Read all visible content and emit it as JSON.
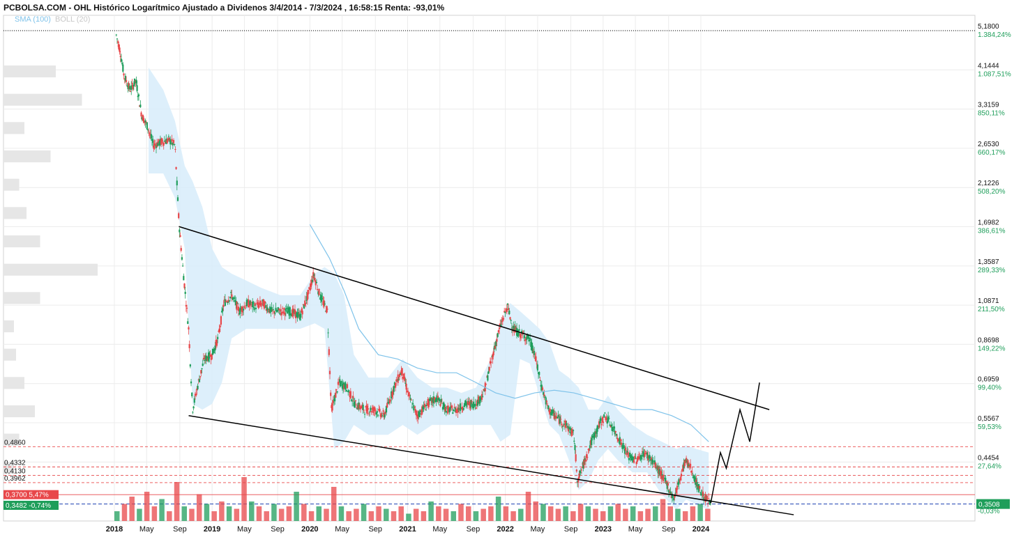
{
  "title": "PCBOLSA.COM - OHL Histórico Logarítmico Ajustado a Dividenos 3/4/2014 - 7/3/2024 , 16:58:15 Renta: -93,01%",
  "legend": {
    "sma": "SMA (100)",
    "boll": "BOLL (20)"
  },
  "colors": {
    "up": "#1f9e5c",
    "down": "#e8474a",
    "sma": "#7fc3ea",
    "boll_fill": "#d7ecfa",
    "trendline": "#000000",
    "level": "#e8474a",
    "current": "#1e9e5a"
  },
  "chart_data": {
    "type": "candlestick",
    "scale": "log",
    "title": "OHL Histórico Logarítmico Ajustado a Dividenos 3/4/2014 - 7/3/2024",
    "ylim": [
      0.33,
      5.3
    ],
    "y_ticks": [
      {
        "value": 5.18,
        "label": "5,1800",
        "pct": "1.384,24%"
      },
      {
        "value": 4.1444,
        "label": "4,1444",
        "pct": "1.087,51%"
      },
      {
        "value": 3.3159,
        "label": "3,3159",
        "pct": "850,11%"
      },
      {
        "value": 2.653,
        "label": "2,6530",
        "pct": "660,17%"
      },
      {
        "value": 2.1226,
        "label": "2,1226",
        "pct": "508,20%"
      },
      {
        "value": 1.6982,
        "label": "1,6982",
        "pct": "386,61%"
      },
      {
        "value": 1.3587,
        "label": "1,3587",
        "pct": "289,33%"
      },
      {
        "value": 1.0871,
        "label": "1,0871",
        "pct": "211,50%"
      },
      {
        "value": 0.8698,
        "label": "0,8698",
        "pct": "149,22%"
      },
      {
        "value": 0.6959,
        "label": "0,6959",
        "pct": "99,40%"
      },
      {
        "value": 0.5567,
        "label": "0,5567",
        "pct": "59,53%"
      },
      {
        "value": 0.4454,
        "label": "0,4454",
        "pct": "27,64%"
      },
      {
        "value": 0.3489,
        "label": "",
        "pct": "-0,03%"
      }
    ],
    "x_ticks": [
      {
        "t": 2018.0,
        "label": "2018",
        "bold": true
      },
      {
        "t": 2018.33,
        "label": "May",
        "bold": false
      },
      {
        "t": 2018.67,
        "label": "Sep",
        "bold": false
      },
      {
        "t": 2019.0,
        "label": "2019",
        "bold": true
      },
      {
        "t": 2019.33,
        "label": "May",
        "bold": false
      },
      {
        "t": 2019.67,
        "label": "Sep",
        "bold": false
      },
      {
        "t": 2020.0,
        "label": "2020",
        "bold": true
      },
      {
        "t": 2020.33,
        "label": "May",
        "bold": false
      },
      {
        "t": 2020.67,
        "label": "Sep",
        "bold": false
      },
      {
        "t": 2021.0,
        "label": "2021",
        "bold": true
      },
      {
        "t": 2021.33,
        "label": "May",
        "bold": false
      },
      {
        "t": 2021.67,
        "label": "Sep",
        "bold": false
      },
      {
        "t": 2022.0,
        "label": "2022",
        "bold": true
      },
      {
        "t": 2022.33,
        "label": "May",
        "bold": false
      },
      {
        "t": 2022.67,
        "label": "Sep",
        "bold": false
      },
      {
        "t": 2023.0,
        "label": "2023",
        "bold": true
      },
      {
        "t": 2023.33,
        "label": "May",
        "bold": false
      },
      {
        "t": 2023.67,
        "label": "Sep",
        "bold": false
      },
      {
        "t": 2024.0,
        "label": "2024",
        "bold": true
      }
    ],
    "levels": [
      {
        "value": 0.486,
        "label": "0,4860"
      },
      {
        "value": 0.4332,
        "label": "0,4332"
      },
      {
        "value": 0.413,
        "label": "0,4130"
      },
      {
        "value": 0.3962,
        "label": "0,3962"
      }
    ],
    "max_line": 5.18,
    "price_tags": [
      {
        "value": 0.37,
        "label": "0,3700",
        "pct": "5,47%",
        "color": "#e8474a"
      },
      {
        "value": 0.3482,
        "label": "0,3482",
        "pct": "-0,74%",
        "color": "#1e9e5a"
      }
    ],
    "last_price": {
      "value": 0.3508,
      "label": "0,3508"
    },
    "price_path": [
      [
        2018.02,
        5.05
      ],
      [
        2018.06,
        4.6
      ],
      [
        2018.1,
        4.0
      ],
      [
        2018.16,
        3.7
      ],
      [
        2018.22,
        3.9
      ],
      [
        2018.28,
        3.2
      ],
      [
        2018.34,
        3.0
      ],
      [
        2018.4,
        2.7
      ],
      [
        2018.48,
        2.75
      ],
      [
        2018.56,
        2.78
      ],
      [
        2018.62,
        2.7
      ],
      [
        2018.66,
        1.75
      ],
      [
        2018.7,
        1.35
      ],
      [
        2018.76,
        0.95
      ],
      [
        2018.8,
        0.6
      ],
      [
        2018.86,
        0.7
      ],
      [
        2018.92,
        0.8
      ],
      [
        2019.0,
        0.82
      ],
      [
        2019.06,
        0.9
      ],
      [
        2019.12,
        1.1
      ],
      [
        2019.2,
        1.15
      ],
      [
        2019.28,
        1.05
      ],
      [
        2019.36,
        1.1
      ],
      [
        2019.44,
        1.08
      ],
      [
        2019.52,
        1.1
      ],
      [
        2019.6,
        1.05
      ],
      [
        2019.7,
        1.05
      ],
      [
        2019.8,
        1.05
      ],
      [
        2019.9,
        1.02
      ],
      [
        2019.98,
        1.15
      ],
      [
        2020.04,
        1.3
      ],
      [
        2020.1,
        1.15
      ],
      [
        2020.18,
        1.05
      ],
      [
        2020.22,
        0.6
      ],
      [
        2020.3,
        0.7
      ],
      [
        2020.38,
        0.68
      ],
      [
        2020.46,
        0.62
      ],
      [
        2020.56,
        0.6
      ],
      [
        2020.66,
        0.6
      ],
      [
        2020.76,
        0.58
      ],
      [
        2020.86,
        0.68
      ],
      [
        2020.94,
        0.75
      ],
      [
        2021.02,
        0.64
      ],
      [
        2021.1,
        0.58
      ],
      [
        2021.2,
        0.62
      ],
      [
        2021.3,
        0.64
      ],
      [
        2021.4,
        0.6
      ],
      [
        2021.5,
        0.6
      ],
      [
        2021.6,
        0.62
      ],
      [
        2021.7,
        0.62
      ],
      [
        2021.78,
        0.66
      ],
      [
        2021.86,
        0.8
      ],
      [
        2021.94,
        0.95
      ],
      [
        2022.02,
        1.08
      ],
      [
        2022.08,
        0.95
      ],
      [
        2022.16,
        0.92
      ],
      [
        2022.24,
        0.9
      ],
      [
        2022.3,
        0.82
      ],
      [
        2022.36,
        0.7
      ],
      [
        2022.44,
        0.6
      ],
      [
        2022.54,
        0.57
      ],
      [
        2022.62,
        0.55
      ],
      [
        2022.7,
        0.52
      ],
      [
        2022.74,
        0.4
      ],
      [
        2022.8,
        0.44
      ],
      [
        2022.88,
        0.5
      ],
      [
        2022.96,
        0.55
      ],
      [
        2023.02,
        0.58
      ],
      [
        2023.1,
        0.54
      ],
      [
        2023.18,
        0.5
      ],
      [
        2023.26,
        0.46
      ],
      [
        2023.34,
        0.45
      ],
      [
        2023.42,
        0.47
      ],
      [
        2023.5,
        0.45
      ],
      [
        2023.58,
        0.42
      ],
      [
        2023.66,
        0.39
      ],
      [
        2023.72,
        0.36
      ],
      [
        2023.78,
        0.4
      ],
      [
        2023.84,
        0.45
      ],
      [
        2023.9,
        0.43
      ],
      [
        2023.96,
        0.39
      ],
      [
        2024.02,
        0.37
      ],
      [
        2024.06,
        0.36
      ],
      [
        2024.1,
        0.352
      ]
    ],
    "sma_path": [
      [
        2020.0,
        1.72
      ],
      [
        2020.2,
        1.42
      ],
      [
        2020.35,
        1.18
      ],
      [
        2020.5,
        0.95
      ],
      [
        2020.7,
        0.82
      ],
      [
        2020.9,
        0.8
      ],
      [
        2021.1,
        0.76
      ],
      [
        2021.3,
        0.74
      ],
      [
        2021.5,
        0.74
      ],
      [
        2021.7,
        0.7
      ],
      [
        2021.9,
        0.66
      ],
      [
        2022.1,
        0.64
      ],
      [
        2022.3,
        0.66
      ],
      [
        2022.5,
        0.67
      ],
      [
        2022.7,
        0.66
      ],
      [
        2022.9,
        0.64
      ],
      [
        2023.1,
        0.62
      ],
      [
        2023.3,
        0.6
      ],
      [
        2023.5,
        0.6
      ],
      [
        2023.7,
        0.58
      ],
      [
        2023.9,
        0.55
      ],
      [
        2024.08,
        0.5
      ]
    ],
    "boll_band": [
      [
        2018.35,
        4.2,
        2.3
      ],
      [
        2018.5,
        3.7,
        2.3
      ],
      [
        2018.62,
        3.1,
        2.0
      ],
      [
        2018.72,
        2.4,
        1.5
      ],
      [
        2018.8,
        2.2,
        0.62
      ],
      [
        2018.9,
        1.9,
        0.6
      ],
      [
        2019.0,
        1.5,
        0.62
      ],
      [
        2019.1,
        1.35,
        0.7
      ],
      [
        2019.2,
        1.3,
        0.9
      ],
      [
        2019.35,
        1.25,
        0.95
      ],
      [
        2019.5,
        1.2,
        0.95
      ],
      [
        2019.7,
        1.15,
        0.95
      ],
      [
        2019.9,
        1.15,
        0.95
      ],
      [
        2020.05,
        1.3,
        0.98
      ],
      [
        2020.15,
        1.35,
        0.95
      ],
      [
        2020.25,
        1.3,
        0.48
      ],
      [
        2020.35,
        1.15,
        0.5
      ],
      [
        2020.45,
        0.82,
        0.55
      ],
      [
        2020.6,
        0.72,
        0.52
      ],
      [
        2020.8,
        0.72,
        0.52
      ],
      [
        2020.95,
        0.8,
        0.55
      ],
      [
        2021.1,
        0.72,
        0.52
      ],
      [
        2021.25,
        0.68,
        0.55
      ],
      [
        2021.4,
        0.68,
        0.55
      ],
      [
        2021.55,
        0.66,
        0.55
      ],
      [
        2021.7,
        0.68,
        0.55
      ],
      [
        2021.85,
        0.8,
        0.55
      ],
      [
        2021.95,
        1.0,
        0.5
      ],
      [
        2022.05,
        1.1,
        0.52
      ],
      [
        2022.15,
        1.05,
        0.8
      ],
      [
        2022.25,
        1.0,
        0.78
      ],
      [
        2022.35,
        0.95,
        0.65
      ],
      [
        2022.45,
        0.88,
        0.55
      ],
      [
        2022.55,
        0.75,
        0.52
      ],
      [
        2022.65,
        0.72,
        0.45
      ],
      [
        2022.75,
        0.68,
        0.38
      ],
      [
        2022.85,
        0.6,
        0.4
      ],
      [
        2022.95,
        0.6,
        0.45
      ],
      [
        2023.05,
        0.65,
        0.48
      ],
      [
        2023.15,
        0.6,
        0.45
      ],
      [
        2023.3,
        0.55,
        0.42
      ],
      [
        2023.45,
        0.52,
        0.42
      ],
      [
        2023.6,
        0.5,
        0.37
      ],
      [
        2023.75,
        0.48,
        0.34
      ],
      [
        2023.85,
        0.49,
        0.36
      ],
      [
        2023.95,
        0.48,
        0.35
      ],
      [
        2024.08,
        0.47,
        0.34
      ]
    ],
    "trendlines": [
      [
        [
          2018.66,
          1.7
        ],
        [
          2024.7,
          0.6
        ]
      ],
      [
        [
          2018.76,
          0.58
        ],
        [
          2024.95,
          0.33
        ]
      ]
    ],
    "projection": [
      [
        2024.1,
        0.352
      ],
      [
        2024.2,
        0.47
      ],
      [
        2024.26,
        0.43
      ],
      [
        2024.4,
        0.6
      ],
      [
        2024.5,
        0.5
      ],
      [
        2024.6,
        0.7
      ]
    ],
    "volume_profile": [
      0.5,
      0.75,
      0.2,
      0.45,
      0.15,
      0.22,
      0.35,
      0.9,
      0.35,
      0.1,
      0.12,
      0.2,
      0.3,
      0.15,
      0.1
    ],
    "volume_bars": [
      0.2,
      0.35,
      0.5,
      0.25,
      0.6,
      0.3,
      0.45,
      0.2,
      0.8,
      0.3,
      0.25,
      0.55,
      0.35,
      0.2,
      0.4,
      0.3,
      0.25,
      0.9,
      0.4,
      0.3,
      0.2,
      0.35,
      0.25,
      0.3,
      0.6,
      0.35,
      0.2,
      0.3,
      0.25,
      0.7,
      0.3,
      0.2,
      0.25,
      0.35,
      0.2,
      0.3,
      0.25,
      0.2,
      0.3,
      0.15,
      0.25,
      0.2,
      0.4,
      0.3,
      0.25,
      0.2,
      0.35,
      0.3,
      0.2,
      0.25,
      0.3,
      0.5,
      0.3,
      0.2,
      0.25,
      0.6,
      0.4,
      0.35,
      0.3,
      0.25,
      0.3,
      0.2,
      0.35,
      0.3,
      0.25,
      0.2,
      0.3,
      0.35,
      0.25,
      0.3,
      0.2,
      0.25,
      0.3,
      0.45,
      0.3,
      0.25,
      0.2,
      0.3,
      0.35,
      0.25
    ]
  }
}
